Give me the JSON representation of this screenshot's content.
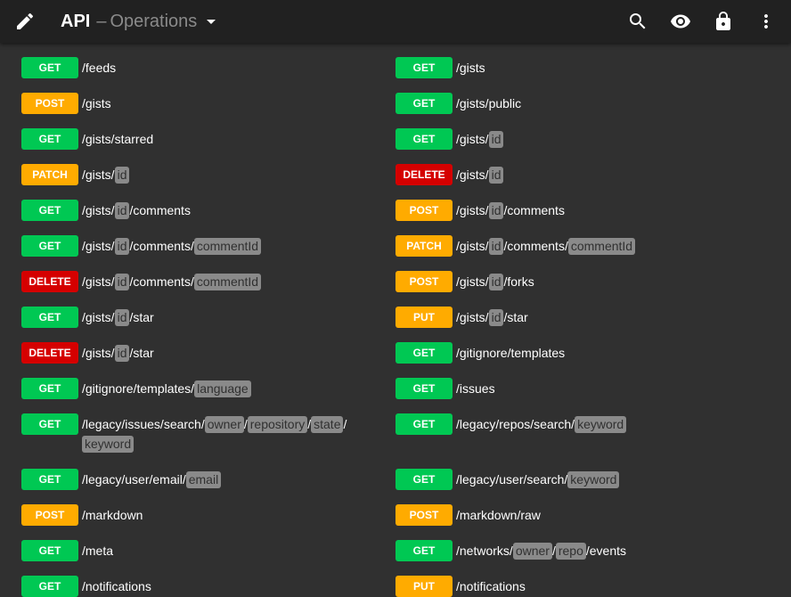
{
  "appbar": {
    "title": "API",
    "separator": "–",
    "subtitle": "Operations",
    "icons": {
      "edit": "edit-icon",
      "dropdown": "arrow-drop-down-icon",
      "search": "search-icon",
      "view": "eye-icon",
      "lock": "lock-icon",
      "more": "more-vert-icon"
    }
  },
  "colors": {
    "get": "#00c853",
    "post": "#ffab00",
    "patch": "#ffab00",
    "put": "#ffab00",
    "delete": "#d50000",
    "param_bg": "#8a8a8a",
    "background": "#303030",
    "appbar": "#212121"
  },
  "operations": [
    {
      "method": "GET",
      "path": [
        {
          "t": "/feeds"
        }
      ]
    },
    {
      "method": "GET",
      "path": [
        {
          "t": "/gists"
        }
      ]
    },
    {
      "method": "POST",
      "path": [
        {
          "t": "/gists"
        }
      ]
    },
    {
      "method": "GET",
      "path": [
        {
          "t": "/gists/public"
        }
      ]
    },
    {
      "method": "GET",
      "path": [
        {
          "t": "/gists/starred"
        }
      ]
    },
    {
      "method": "GET",
      "path": [
        {
          "t": "/gists/"
        },
        {
          "p": "id"
        }
      ]
    },
    {
      "method": "PATCH",
      "path": [
        {
          "t": "/gists/"
        },
        {
          "p": "id"
        }
      ]
    },
    {
      "method": "DELETE",
      "path": [
        {
          "t": "/gists/"
        },
        {
          "p": "id"
        }
      ]
    },
    {
      "method": "GET",
      "path": [
        {
          "t": "/gists/"
        },
        {
          "p": "id"
        },
        {
          "t": "/comments"
        }
      ]
    },
    {
      "method": "POST",
      "path": [
        {
          "t": "/gists/"
        },
        {
          "p": "id"
        },
        {
          "t": "/comments"
        }
      ]
    },
    {
      "method": "GET",
      "path": [
        {
          "t": "/gists/"
        },
        {
          "p": "id"
        },
        {
          "t": "/comments/"
        },
        {
          "p": "commentId"
        }
      ]
    },
    {
      "method": "PATCH",
      "path": [
        {
          "t": "/gists/"
        },
        {
          "p": "id"
        },
        {
          "t": "/comments/"
        },
        {
          "p": "commentId"
        }
      ]
    },
    {
      "method": "DELETE",
      "path": [
        {
          "t": "/gists/"
        },
        {
          "p": "id"
        },
        {
          "t": "/comments/"
        },
        {
          "p": "commentId"
        }
      ]
    },
    {
      "method": "POST",
      "path": [
        {
          "t": "/gists/"
        },
        {
          "p": "id"
        },
        {
          "t": "/forks"
        }
      ]
    },
    {
      "method": "GET",
      "path": [
        {
          "t": "/gists/"
        },
        {
          "p": "id"
        },
        {
          "t": "/star"
        }
      ]
    },
    {
      "method": "PUT",
      "path": [
        {
          "t": "/gists/"
        },
        {
          "p": "id"
        },
        {
          "t": "/star"
        }
      ]
    },
    {
      "method": "DELETE",
      "path": [
        {
          "t": "/gists/"
        },
        {
          "p": "id"
        },
        {
          "t": "/star"
        }
      ]
    },
    {
      "method": "GET",
      "path": [
        {
          "t": "/gitignore/templates"
        }
      ]
    },
    {
      "method": "GET",
      "path": [
        {
          "t": "/gitignore/templates/"
        },
        {
          "p": "language"
        }
      ]
    },
    {
      "method": "GET",
      "path": [
        {
          "t": "/issues"
        }
      ]
    },
    {
      "method": "GET",
      "path": [
        {
          "t": "/legacy/issues/search/"
        },
        {
          "p": "owner"
        },
        {
          "t": "/"
        },
        {
          "p": "repository"
        },
        {
          "t": "/"
        },
        {
          "p": "state"
        },
        {
          "t": "/"
        },
        {
          "p": "keyword"
        }
      ]
    },
    {
      "method": "GET",
      "path": [
        {
          "t": "/legacy/repos/search/"
        },
        {
          "p": "keyword"
        }
      ]
    },
    {
      "method": "GET",
      "path": [
        {
          "t": "/legacy/user/email/"
        },
        {
          "p": "email"
        }
      ]
    },
    {
      "method": "GET",
      "path": [
        {
          "t": "/legacy/user/search/"
        },
        {
          "p": "keyword"
        }
      ]
    },
    {
      "method": "POST",
      "path": [
        {
          "t": "/markdown"
        }
      ]
    },
    {
      "method": "POST",
      "path": [
        {
          "t": "/markdown/raw"
        }
      ]
    },
    {
      "method": "GET",
      "path": [
        {
          "t": "/meta"
        }
      ]
    },
    {
      "method": "GET",
      "path": [
        {
          "t": "/networks/"
        },
        {
          "p": "owner"
        },
        {
          "t": "/"
        },
        {
          "p": "repo"
        },
        {
          "t": "/events"
        }
      ]
    },
    {
      "method": "GET",
      "path": [
        {
          "t": "/notifications"
        }
      ]
    },
    {
      "method": "PUT",
      "path": [
        {
          "t": "/notifications"
        }
      ]
    }
  ]
}
